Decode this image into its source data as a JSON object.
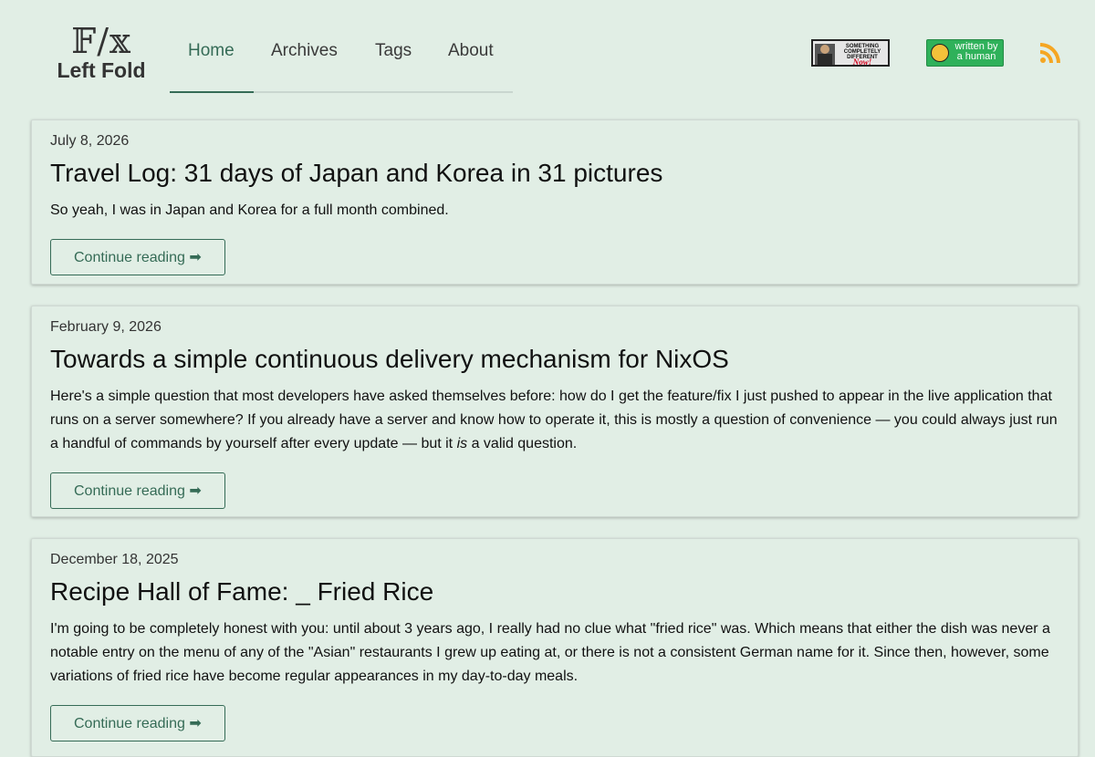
{
  "header": {
    "logo_glyph": "𝔽/𝕩",
    "logo_name": "Left Fold",
    "nav": [
      {
        "label": "Home",
        "active": true
      },
      {
        "label": "Archives",
        "active": false
      },
      {
        "label": "Tags",
        "active": false
      },
      {
        "label": "About",
        "active": false
      }
    ],
    "badges": {
      "scd_text": [
        "SOMETHING",
        "COMPLETELY",
        "DIFFERENT",
        "Now!"
      ],
      "human_text": "written by a human"
    }
  },
  "posts": [
    {
      "date": "July 8, 2026",
      "title": "Travel Log: 31 days of Japan and Korea in 31 pictures",
      "excerpt": "So yeah, I was in Japan and Korea for a full month combined.",
      "button": "Continue reading ➡"
    },
    {
      "date": "February 9, 2026",
      "title": "Towards a simple continuous delivery mechanism for NixOS",
      "excerpt_before": "Here's a simple question that most developers have asked themselves before: how do I get the feature/fix I just pushed to appear in the live application that runs on a server somewhere? If you already have a server and know how to operate it, this is mostly a question of convenience — you could always just run a handful of commands by yourself after every update — but it ",
      "excerpt_em": "is",
      "excerpt_after": " a valid question.",
      "button": "Continue reading ➡"
    },
    {
      "date": "December 18, 2025",
      "title": "Recipe Hall of Fame: _ Fried Rice",
      "excerpt": "I'm going to be completely honest with you: until about 3 years ago, I really had no clue what \"fried rice\" was. Which means that either the dish was never a notable entry on the menu of any of the \"Asian\" restaurants I grew up eating at, or there is not a consistent German name for it. Since then, however, some variations of fried rice have become regular appearances in my day-to-day meals.",
      "button": "Continue reading ➡"
    }
  ],
  "colors": {
    "background": "#e1eee5",
    "accent": "#356b56",
    "rss": "#f5a623"
  }
}
